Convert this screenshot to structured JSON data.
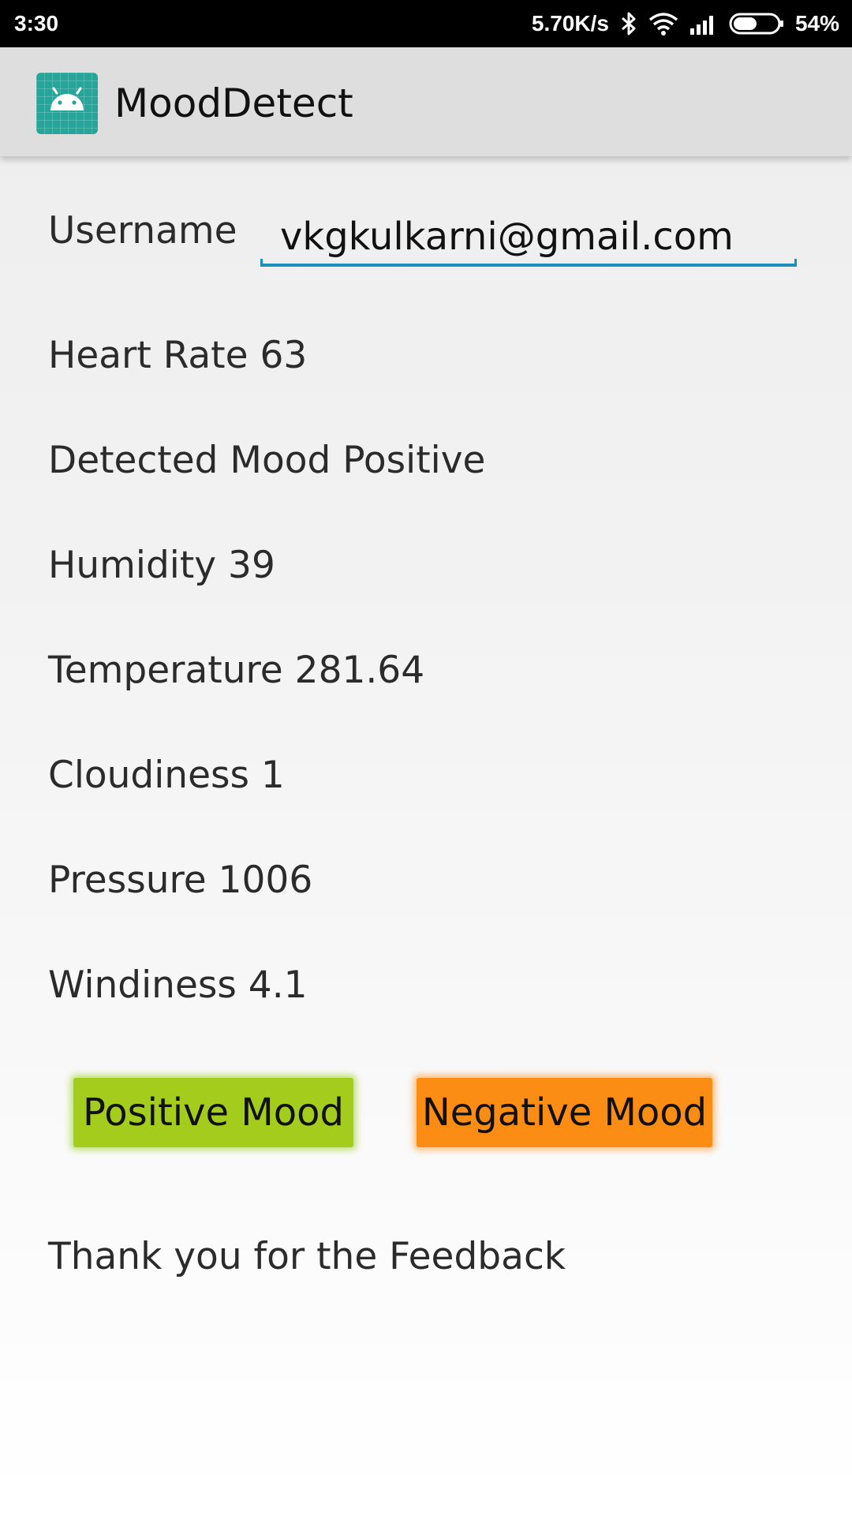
{
  "status_bar": {
    "time": "3:30",
    "net_speed": "5.70K/s",
    "battery_percent": "54%",
    "battery_level": 0.54,
    "icons": [
      "bluetooth-icon",
      "wifi-icon",
      "signal-icon",
      "battery-icon"
    ]
  },
  "app_bar": {
    "title": "MoodDetect",
    "icon": "android-icon",
    "icon_color": "#26a69a"
  },
  "form": {
    "username_label": "Username",
    "username_value": "vkgkulkarni@gmail.com"
  },
  "readings": {
    "heart_rate": "Heart Rate 63",
    "detected_mood": "Detected Mood Positive",
    "humidity": "Humidity 39",
    "temperature": "Temperature 281.64",
    "cloudiness": "Cloudiness 1",
    "pressure": "Pressure 1006",
    "windiness": "Windiness 4.1"
  },
  "buttons": {
    "positive_label": "Positive Mood",
    "negative_label": "Negative Mood",
    "positive_color": "#a3cc1c",
    "negative_color": "#fb8c14"
  },
  "feedback_message": "Thank you for the Feedback",
  "accent_color": "#1e8fb8"
}
